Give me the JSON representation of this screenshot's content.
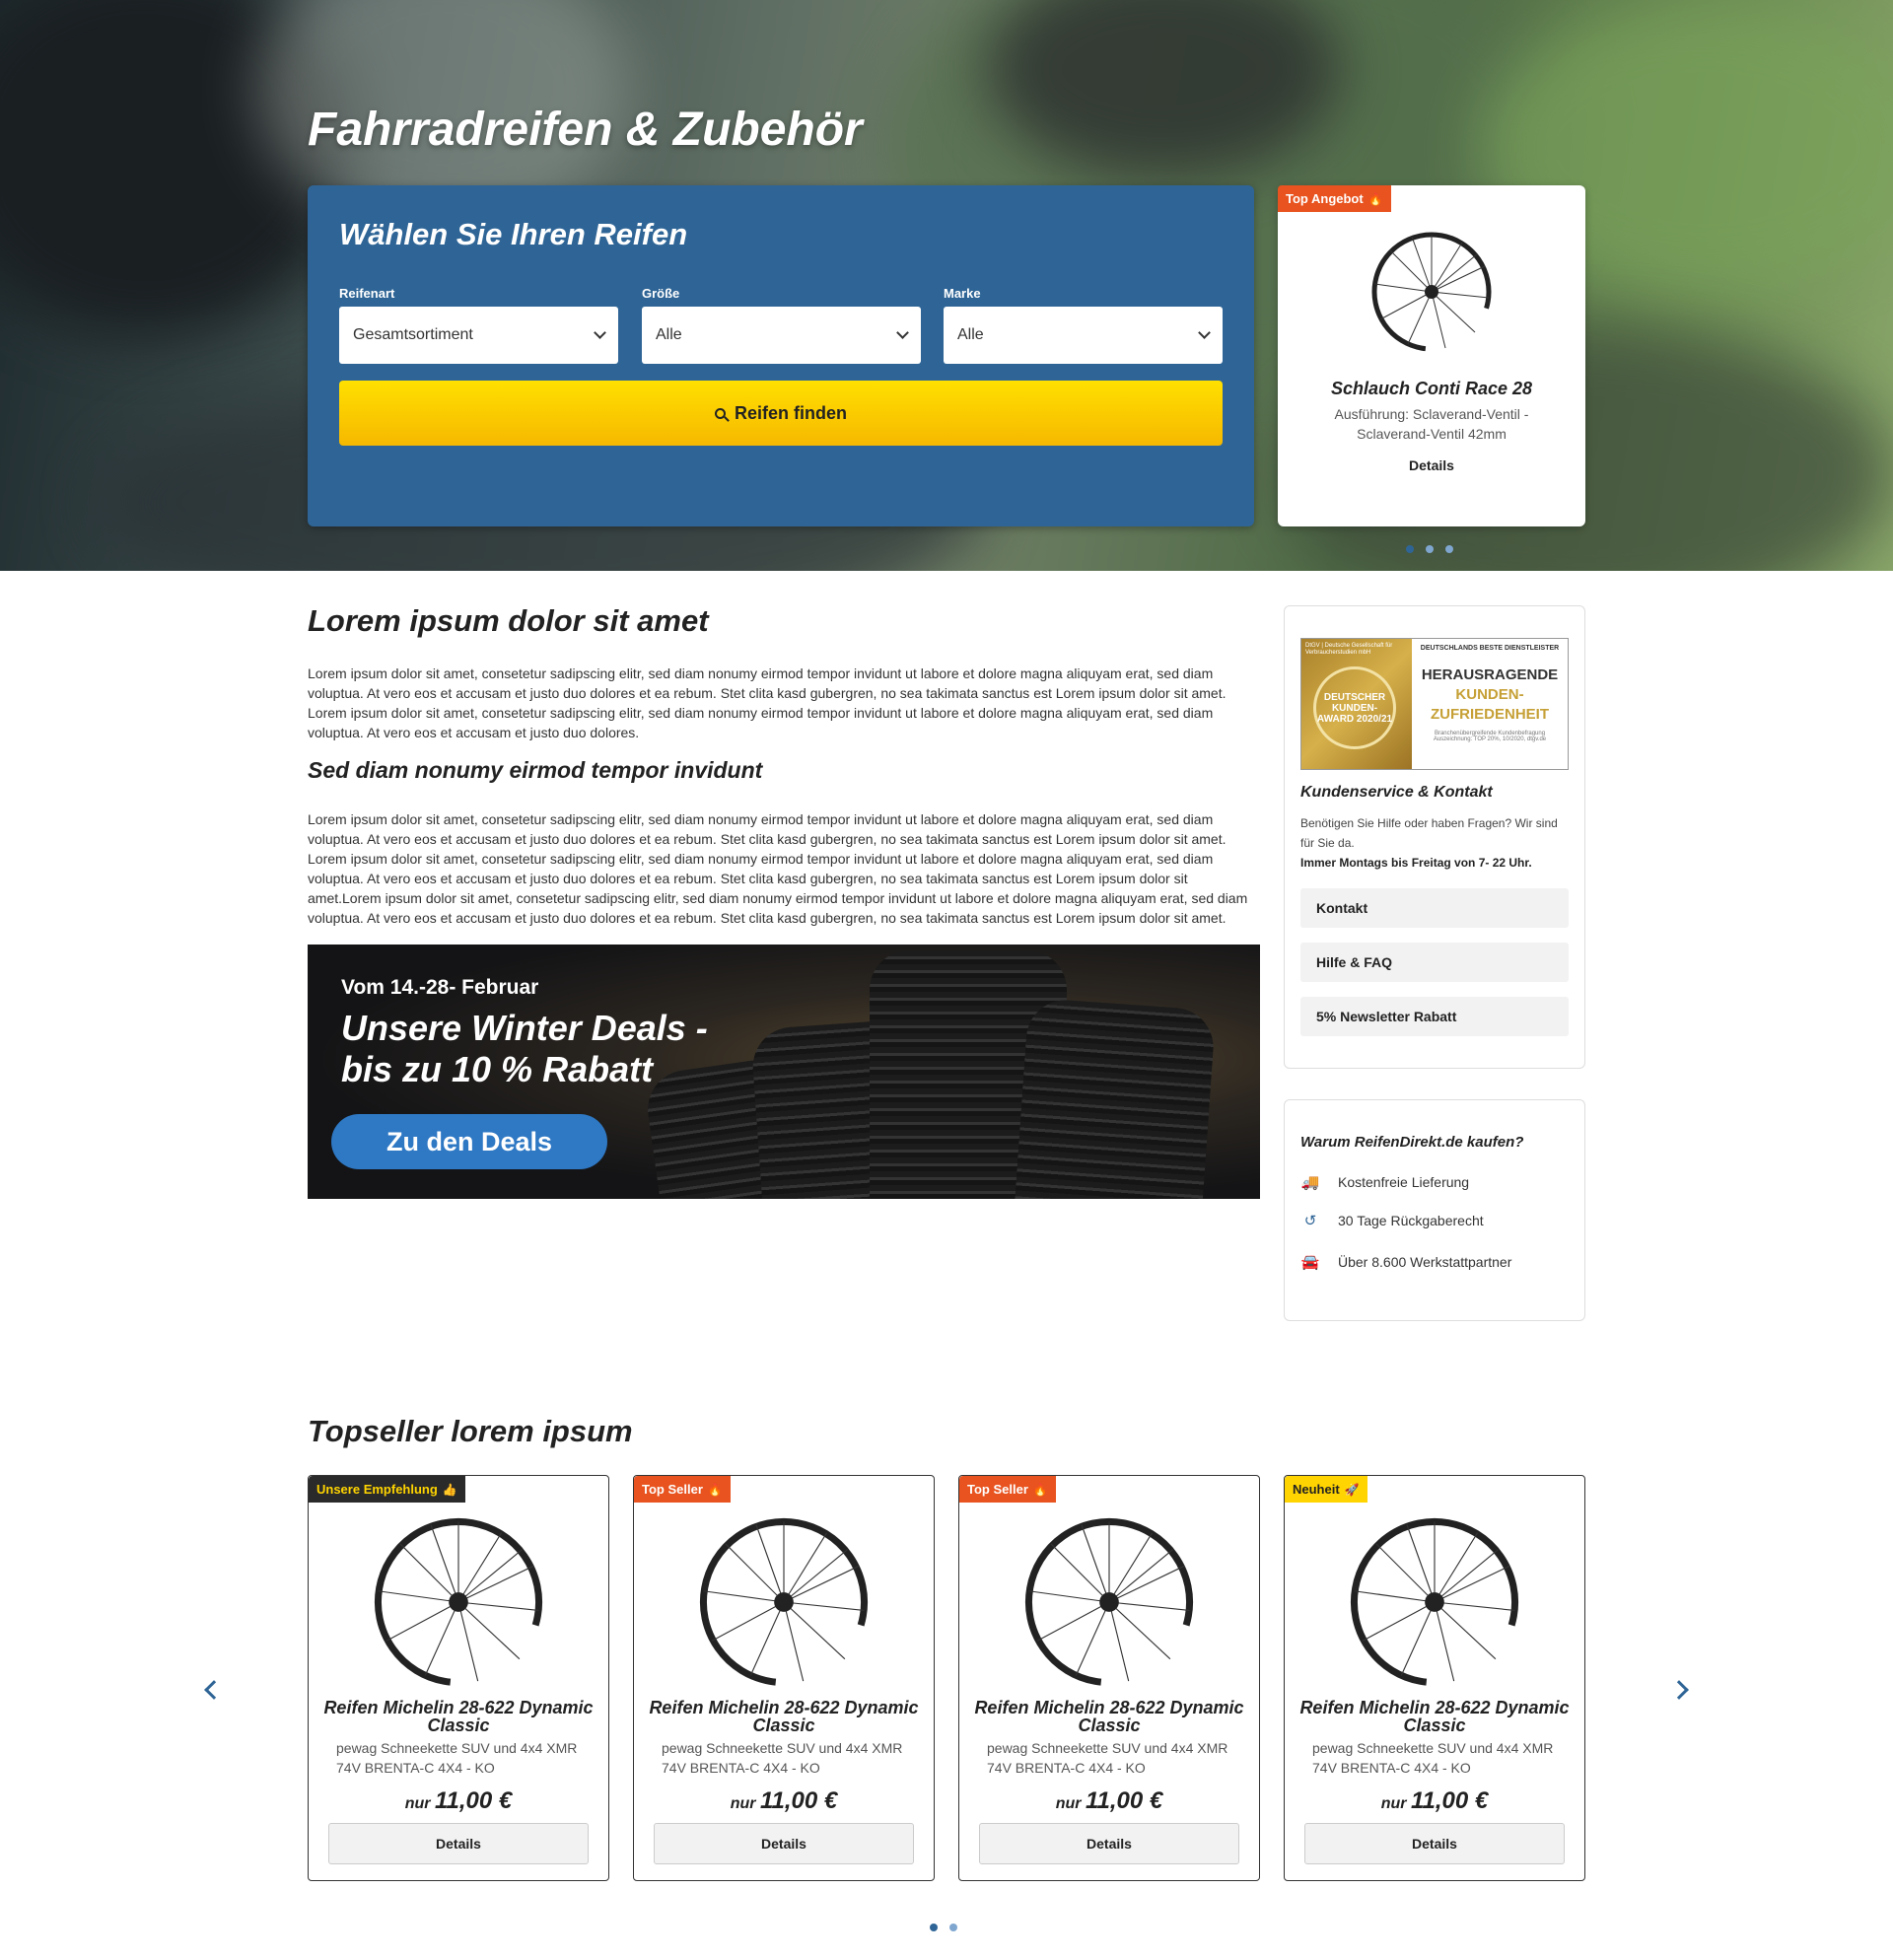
{
  "hero": {
    "title": "Fahrradreifen & Zubehör"
  },
  "selector": {
    "heading": "Wählen Sie Ihren Reifen",
    "fields": [
      {
        "label": "Reifenart",
        "value": "Gesamtsortiment"
      },
      {
        "label": "Größe",
        "value": "Alle"
      },
      {
        "label": "Marke",
        "value": "Alle"
      }
    ],
    "button": "Reifen finden"
  },
  "offer": {
    "badge": "Top Angebot",
    "badge_icon": "flame-icon",
    "title": "Schlauch Conti Race 28",
    "desc": "Ausführung: Sclaverand-Ventil - Sclaverand-Ventil 42mm",
    "details": "Details",
    "slides": 3,
    "active_slide": 1
  },
  "main": {
    "h1": "Lorem ipsum dolor sit amet",
    "p1": "Lorem ipsum dolor sit amet, consetetur sadipscing elitr, sed diam nonumy eirmod tempor invidunt ut labore et dolore magna aliquyam erat, sed diam voluptua. At vero eos et accusam et justo duo dolores et ea rebum. Stet clita kasd gubergren, no sea takimata sanctus est Lorem ipsum dolor sit amet. Lorem ipsum dolor sit amet, consetetur sadipscing elitr, sed diam nonumy eirmod tempor invidunt ut labore et dolore magna aliquyam erat, sed diam voluptua. At vero eos et accusam et justo duo dolores.",
    "h2": "Sed diam nonumy eirmod tempor invidunt",
    "p2": "Lorem ipsum dolor sit amet, consetetur sadipscing elitr, sed diam nonumy eirmod tempor invidunt ut labore et dolore magna aliquyam erat, sed diam voluptua. At vero eos et accusam et justo duo dolores et ea rebum. Stet clita kasd gubergren, no sea takimata sanctus est Lorem ipsum dolor sit amet. Lorem ipsum dolor sit amet, consetetur sadipscing elitr, sed diam nonumy eirmod tempor invidunt ut labore et dolore magna aliquyam erat, sed diam voluptua. At vero eos et accusam et justo duo dolores et ea rebum. Stet clita kasd gubergren, no sea takimata sanctus est Lorem ipsum dolor sit amet.Lorem ipsum dolor sit amet, consetetur sadipscing elitr, sed diam nonumy eirmod tempor invidunt ut labore et dolore magna aliquyam erat, sed diam voluptua. At vero eos et accusam et justo duo dolores et ea rebum. Stet clita kasd gubergren, no sea takimata sanctus est Lorem ipsum dolor sit amet."
  },
  "promo": {
    "date": "Vom 14.-28- Februar",
    "headline_1": "Unsere Winter Deals -",
    "headline_2": "bis zu 10 % Rabatt",
    "cta": "Zu den Deals"
  },
  "award": {
    "org": "DtGV | Deutsche Gesellschaft für Verbraucherstudien mbH",
    "seal": "DEUTSCHER KUNDEN-AWARD 2020/21",
    "top": "DEUTSCHLANDS BESTE DIENSTLEISTER",
    "line1": "HERAUSRAGENDE",
    "line2": "KUNDEN-",
    "line3": "ZUFRIEDENHEIT",
    "fine": "Branchenübergreifende Kundenbefragung Auszeichnung: TOP 20%, 10/2020, dtgv.de"
  },
  "service": {
    "title": "Kundenservice & Kontakt",
    "text": "Benötigen Sie Hilfe oder haben Fragen? Wir sind für Sie da.",
    "hours": "Immer Montags bis Freitag von 7- 22 Uhr.",
    "buttons": [
      "Kontakt",
      "Hilfe & FAQ",
      "5% Newsletter Rabatt"
    ]
  },
  "why": {
    "title": "Warum ReifenDirekt.de kaufen?",
    "items": [
      {
        "icon": "truck-icon",
        "label": "Kostenfreie Lieferung"
      },
      {
        "icon": "return-clock-icon",
        "label": "30 Tage Rückgaberecht"
      },
      {
        "icon": "car-workshop-icon",
        "label": "Über 8.600 Werkstattpartner"
      }
    ]
  },
  "topseller": {
    "title": "Topseller lorem ipsum",
    "cards": [
      {
        "badge": "Unsere Empfehlung",
        "badge_icon": "thumbs-up-icon",
        "name": "Reifen Michelin 28-622 Dynamic Classic",
        "desc": "pewag Schneekette SUV und 4x4 XMR 74V BRENTA-C 4X4 - KO",
        "nur": "nur",
        "price": "11,00 €",
        "details": "Details"
      },
      {
        "badge": "Top Seller",
        "badge_icon": "flame-icon",
        "name": "Reifen Michelin 28-622 Dynamic Classic",
        "desc": "pewag Schneekette SUV und 4x4 XMR 74V BRENTA-C 4X4 - KO",
        "nur": "nur",
        "price": "11,00 €",
        "details": "Details"
      },
      {
        "badge": "Top Seller",
        "badge_icon": "flame-icon",
        "name": "Reifen Michelin 28-622 Dynamic Classic",
        "desc": "pewag Schneekette SUV und 4x4 XMR 74V BRENTA-C 4X4 - KO",
        "nur": "nur",
        "price": "11,00 €",
        "details": "Details"
      },
      {
        "badge": "Neuheit",
        "badge_icon": "rocket-icon",
        "name": "Reifen Michelin 28-622 Dynamic Classic",
        "desc": "pewag Schneekette SUV und 4x4 XMR 74V BRENTA-C 4X4 - KO",
        "nur": "nur",
        "price": "11,00 €",
        "details": "Details"
      }
    ],
    "pages": 2,
    "active_page": 1
  },
  "colors": {
    "brand_blue": "#2f6596",
    "cta_yellow": "#ffd400",
    "badge_orange": "#e8531f"
  }
}
